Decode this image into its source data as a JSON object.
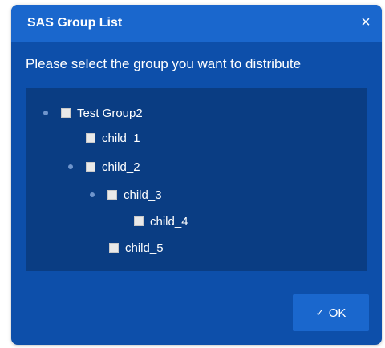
{
  "dialog": {
    "title": "SAS Group List",
    "close_glyph": "×",
    "prompt": "Please select the group you want to distribute",
    "ok_label": "OK",
    "ok_icon": "✓"
  },
  "tree": {
    "root": "Test Group2",
    "child_1": "child_1",
    "child_2": "child_2",
    "child_3": "child_3",
    "child_4": "child_4",
    "child_5": "child_5"
  },
  "colors": {
    "dialog_bg": "#0d4faa",
    "titlebar_bg": "#1a67cd",
    "tree_bg": "#0a3d83",
    "button_bg": "#1a67cd",
    "text": "#ffffff"
  }
}
